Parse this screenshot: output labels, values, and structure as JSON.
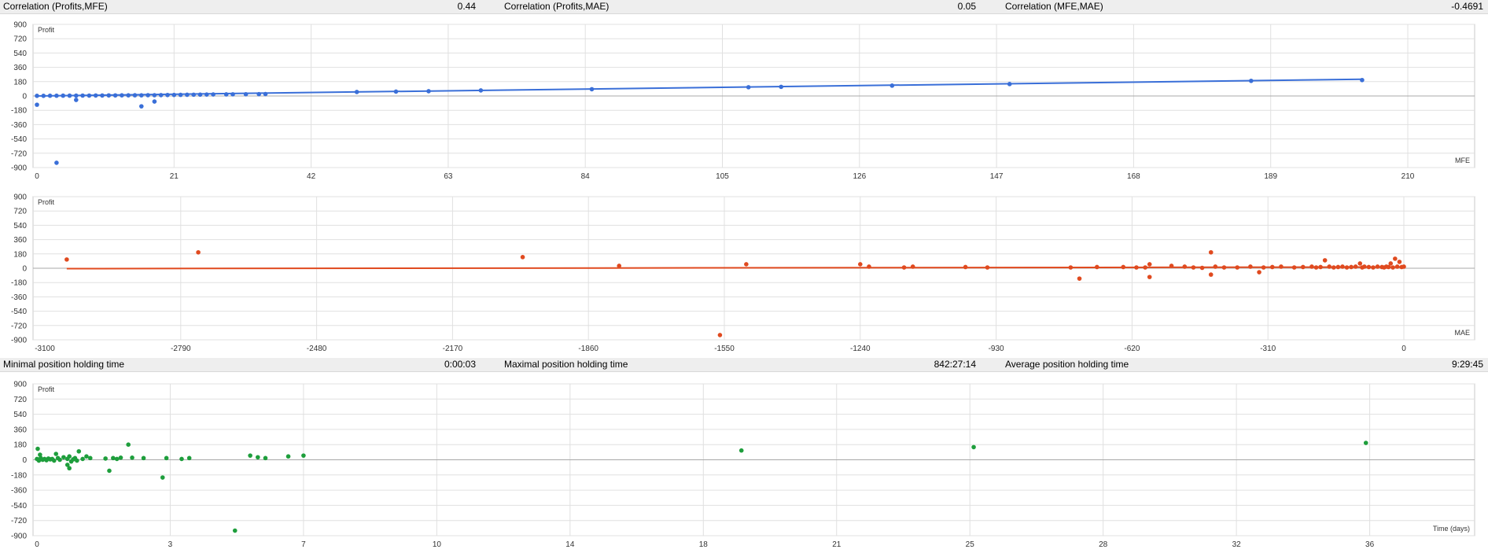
{
  "stats_top": {
    "corr_profits_mfe_label": "Correlation (Profits,MFE)",
    "corr_profits_mfe_value": "0.44",
    "corr_profits_mae_label": "Correlation (Profits,MAE)",
    "corr_profits_mae_value": "0.05",
    "corr_mfe_mae_label": "Correlation (MFE,MAE)",
    "corr_mfe_mae_value": "-0.4691"
  },
  "stats_middle": {
    "min_hold_label": "Minimal position holding time",
    "min_hold_value": "0:00:03",
    "max_hold_label": "Maximal position holding time",
    "max_hold_value": "842:27:14",
    "avg_hold_label": "Average position holding time",
    "avg_hold_value": "9:29:45"
  },
  "colors": {
    "mfe": "#3a6fd8",
    "mae": "#e04a1f",
    "time": "#1e9e3c",
    "grid": "#e0e0e0",
    "zero": "#a8a8a8"
  },
  "chart_data": [
    {
      "type": "scatter",
      "ylabel": "Profit",
      "xlabel": "MFE",
      "xlim": [
        0,
        210
      ],
      "ylim": [
        -900,
        900
      ],
      "xticks": [
        0,
        21,
        42,
        63,
        84,
        105,
        126,
        147,
        168,
        189,
        210
      ],
      "yticks": [
        900,
        720,
        540,
        360,
        180,
        0,
        -180,
        -360,
        -540,
        -720,
        -900
      ],
      "series": [
        {
          "color": "#3a6fd8",
          "trendline": [
            [
              0,
              0
            ],
            [
              203,
              210
            ]
          ],
          "points": [
            [
              0,
              2
            ],
            [
              0,
              -110
            ],
            [
              1,
              2
            ],
            [
              2,
              3
            ],
            [
              3,
              3
            ],
            [
              3,
              -840
            ],
            [
              4,
              4
            ],
            [
              5,
              4
            ],
            [
              6,
              4
            ],
            [
              6,
              -50
            ],
            [
              7,
              5
            ],
            [
              8,
              5
            ],
            [
              9,
              6
            ],
            [
              10,
              6
            ],
            [
              11,
              7
            ],
            [
              12,
              7
            ],
            [
              13,
              8
            ],
            [
              14,
              8
            ],
            [
              15,
              9
            ],
            [
              16,
              8
            ],
            [
              16,
              -130
            ],
            [
              17,
              10
            ],
            [
              18,
              10
            ],
            [
              18,
              -70
            ],
            [
              19,
              11
            ],
            [
              20,
              12
            ],
            [
              21,
              13
            ],
            [
              22,
              14
            ],
            [
              23,
              15
            ],
            [
              24,
              16
            ],
            [
              25,
              17
            ],
            [
              26,
              18
            ],
            [
              27,
              19
            ],
            [
              29,
              20
            ],
            [
              30,
              21
            ],
            [
              32,
              22
            ],
            [
              34,
              23
            ],
            [
              35,
              24
            ],
            [
              49,
              50
            ],
            [
              55,
              55
            ],
            [
              60,
              60
            ],
            [
              68,
              70
            ],
            [
              85,
              85
            ],
            [
              109,
              110
            ],
            [
              114,
              115
            ],
            [
              131,
              130
            ],
            [
              149,
              150
            ],
            [
              186,
              190
            ],
            [
              203,
              200
            ]
          ]
        }
      ]
    },
    {
      "type": "scatter",
      "ylabel": "Profit",
      "xlabel": "MAE",
      "xlim": [
        -3100,
        0
      ],
      "ylim": [
        -900,
        900
      ],
      "xticks": [
        -3100,
        -2790,
        -2480,
        -2170,
        -1860,
        -1550,
        -1240,
        -930,
        -620,
        -310,
        0
      ],
      "yticks": [
        900,
        720,
        540,
        360,
        180,
        0,
        -180,
        -360,
        -540,
        -720,
        -900
      ],
      "series": [
        {
          "color": "#e04a1f",
          "trendline": [
            [
              -3050,
              -5
            ],
            [
              0,
              15
            ]
          ],
          "points": [
            [
              -3050,
              110
            ],
            [
              -2750,
              200
            ],
            [
              -2010,
              140
            ],
            [
              -1790,
              30
            ],
            [
              -1560,
              -840
            ],
            [
              -1500,
              50
            ],
            [
              -1240,
              50
            ],
            [
              -1220,
              20
            ],
            [
              -1140,
              10
            ],
            [
              -1120,
              20
            ],
            [
              -1000,
              15
            ],
            [
              -950,
              10
            ],
            [
              -760,
              10
            ],
            [
              -740,
              -130
            ],
            [
              -700,
              15
            ],
            [
              -640,
              15
            ],
            [
              -610,
              10
            ],
            [
              -590,
              10
            ],
            [
              -580,
              50
            ],
            [
              -580,
              -110
            ],
            [
              -530,
              30
            ],
            [
              -500,
              20
            ],
            [
              -480,
              10
            ],
            [
              -460,
              5
            ],
            [
              -440,
              200
            ],
            [
              -440,
              -80
            ],
            [
              -430,
              20
            ],
            [
              -410,
              10
            ],
            [
              -380,
              10
            ],
            [
              -350,
              20
            ],
            [
              -330,
              -50
            ],
            [
              -320,
              10
            ],
            [
              -300,
              15
            ],
            [
              -280,
              20
            ],
            [
              -250,
              10
            ],
            [
              -230,
              15
            ],
            [
              -210,
              20
            ],
            [
              -200,
              10
            ],
            [
              -190,
              15
            ],
            [
              -180,
              100
            ],
            [
              -170,
              20
            ],
            [
              -160,
              10
            ],
            [
              -150,
              15
            ],
            [
              -140,
              20
            ],
            [
              -130,
              10
            ],
            [
              -120,
              15
            ],
            [
              -110,
              20
            ],
            [
              -100,
              60
            ],
            [
              -95,
              10
            ],
            [
              -90,
              20
            ],
            [
              -80,
              15
            ],
            [
              -70,
              10
            ],
            [
              -60,
              20
            ],
            [
              -50,
              15
            ],
            [
              -45,
              10
            ],
            [
              -40,
              20
            ],
            [
              -35,
              15
            ],
            [
              -30,
              60
            ],
            [
              -25,
              10
            ],
            [
              -20,
              120
            ],
            [
              -15,
              20
            ],
            [
              -10,
              80
            ],
            [
              -5,
              15
            ],
            [
              0,
              20
            ]
          ]
        }
      ]
    },
    {
      "type": "scatter",
      "ylabel": "Profit",
      "xlabel": "Time (days)",
      "xlim": [
        0,
        36
      ],
      "ylim": [
        -900,
        900
      ],
      "xticks": [
        0,
        3,
        7,
        10,
        14,
        18,
        21,
        25,
        28,
        32,
        36
      ],
      "xtick_positions": [
        0,
        3.5,
        7,
        10.5,
        14,
        17.5,
        21,
        24.5,
        28,
        31.5,
        35
      ],
      "yticks": [
        900,
        720,
        540,
        360,
        180,
        0,
        -180,
        -360,
        -540,
        -720,
        -900
      ],
      "series": [
        {
          "color": "#1e9e3c",
          "points": [
            [
              0,
              10
            ],
            [
              0.02,
              130
            ],
            [
              0.05,
              -10
            ],
            [
              0.08,
              60
            ],
            [
              0.1,
              20
            ],
            [
              0.15,
              0
            ],
            [
              0.2,
              10
            ],
            [
              0.25,
              -5
            ],
            [
              0.3,
              15
            ],
            [
              0.35,
              5
            ],
            [
              0.4,
              10
            ],
            [
              0.45,
              -10
            ],
            [
              0.5,
              70
            ],
            [
              0.55,
              20
            ],
            [
              0.6,
              0
            ],
            [
              0.7,
              30
            ],
            [
              0.8,
              10
            ],
            [
              0.85,
              40
            ],
            [
              0.9,
              -20
            ],
            [
              0.95,
              5
            ],
            [
              0.8,
              -60
            ],
            [
              0.85,
              -100
            ],
            [
              1.0,
              20
            ],
            [
              1.05,
              -10
            ],
            [
              1.1,
              100
            ],
            [
              1.2,
              10
            ],
            [
              1.3,
              40
            ],
            [
              1.4,
              20
            ],
            [
              1.8,
              15
            ],
            [
              1.9,
              -130
            ],
            [
              2.0,
              20
            ],
            [
              2.1,
              10
            ],
            [
              2.2,
              25
            ],
            [
              2.4,
              180
            ],
            [
              2.5,
              25
            ],
            [
              2.8,
              20
            ],
            [
              3.3,
              -210
            ],
            [
              3.4,
              20
            ],
            [
              3.8,
              10
            ],
            [
              4.0,
              20
            ],
            [
              5.2,
              -840
            ],
            [
              5.6,
              50
            ],
            [
              5.8,
              30
            ],
            [
              6.0,
              20
            ],
            [
              6.6,
              40
            ],
            [
              7.0,
              50
            ],
            [
              18.5,
              110
            ],
            [
              24.6,
              150
            ],
            [
              34.9,
              200
            ]
          ]
        }
      ]
    }
  ]
}
